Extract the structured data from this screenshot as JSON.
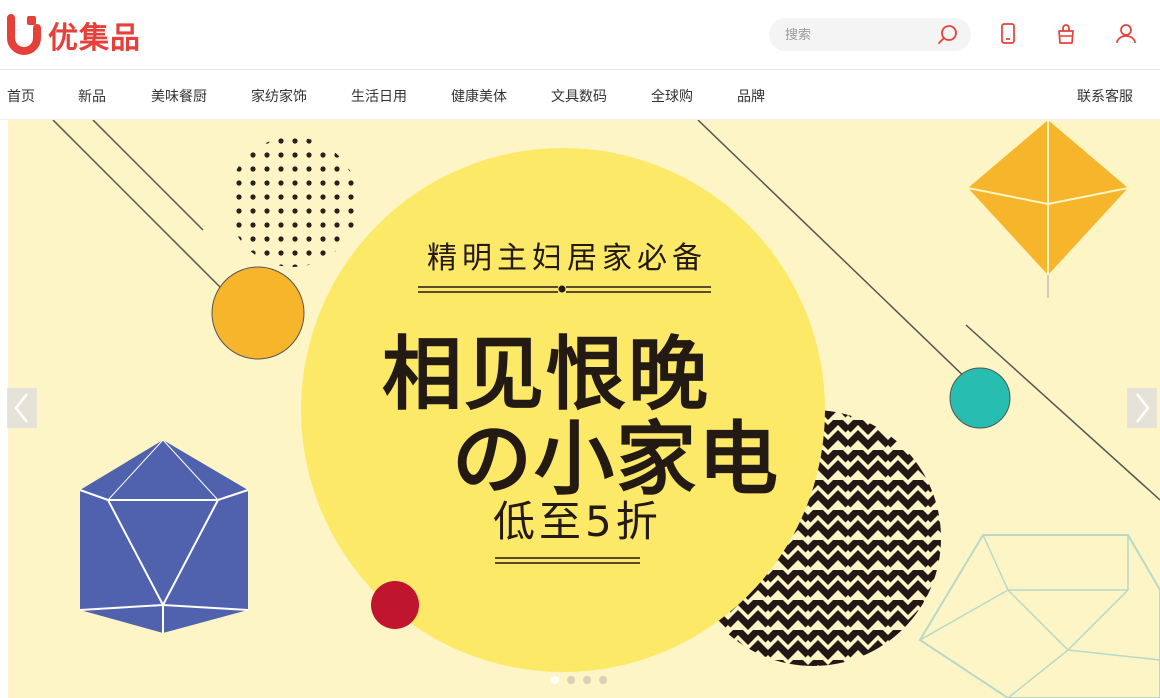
{
  "header": {
    "brand_name": "优集品",
    "search_placeholder": "搜索",
    "icons": [
      "logo-icon",
      "search-icon",
      "mobile-icon",
      "cart-icon",
      "user-icon"
    ]
  },
  "nav": {
    "items": [
      "首页",
      "新品",
      "美味餐厨",
      "家纺家饰",
      "生活日用",
      "健康美体",
      "文具数码",
      "全球购",
      "品牌"
    ],
    "service": "联系客服"
  },
  "banner": {
    "subtitle": "精明主妇居家必备",
    "headline_line1": "相见恨晚",
    "headline_line2": "の小家电",
    "discount": "低至5折",
    "slide_count": 4,
    "active_slide": 1
  },
  "colors": {
    "brand_red": "#e5413a",
    "banner_bg": "#fdf5c5",
    "circle_yellow": "#fde968",
    "orange": "#f7b52c",
    "teal": "#27bdb0",
    "crimson": "#c0152f",
    "indigo": "#5062ae"
  }
}
